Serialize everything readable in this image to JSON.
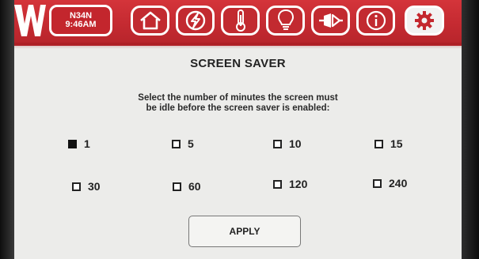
{
  "header": {
    "station_id": "N34N",
    "time": "9:46AM",
    "nav": [
      {
        "icon": "home-icon"
      },
      {
        "icon": "power-icon"
      },
      {
        "icon": "thermometer-icon"
      },
      {
        "icon": "lightbulb-icon"
      },
      {
        "icon": "connector-icon"
      },
      {
        "icon": "info-icon"
      },
      {
        "icon": "gear-icon",
        "active": true
      }
    ]
  },
  "page": {
    "title": "SCREEN SAVER",
    "description_line1": "Select the number of minutes the screen must",
    "description_line2": "be idle before the screen saver is enabled:"
  },
  "options": [
    {
      "label": "1",
      "checked": true
    },
    {
      "label": "5",
      "checked": false
    },
    {
      "label": "10",
      "checked": false
    },
    {
      "label": "15",
      "checked": false
    },
    {
      "label": "30",
      "checked": false
    },
    {
      "label": "60",
      "checked": false
    },
    {
      "label": "120",
      "checked": false
    },
    {
      "label": "240",
      "checked": false
    }
  ],
  "apply_label": "APPLY",
  "colors": {
    "header_red": "#c42a31",
    "screen_bg": "#ececea",
    "text": "#222222"
  }
}
